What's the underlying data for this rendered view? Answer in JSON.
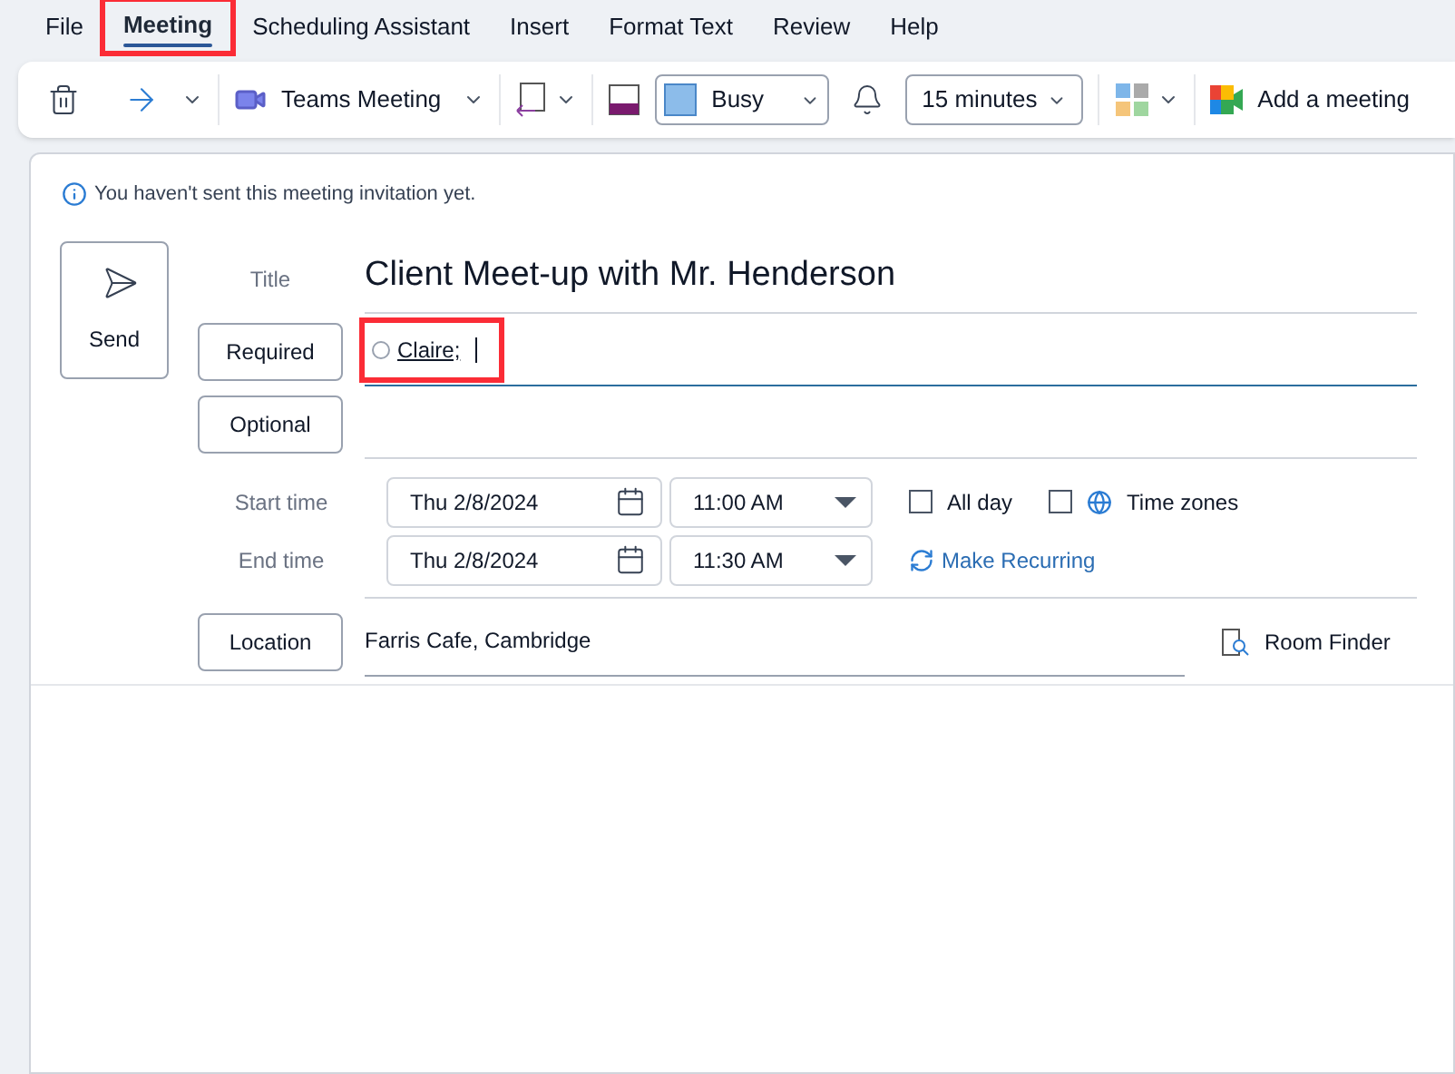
{
  "menu_tabs": [
    {
      "label": "File",
      "selected": false,
      "highlighted": false
    },
    {
      "label": "Meeting",
      "selected": true,
      "highlighted": true
    },
    {
      "label": "Scheduling Assistant",
      "selected": false,
      "highlighted": false
    },
    {
      "label": "Insert",
      "selected": false,
      "highlighted": false
    },
    {
      "label": "Format Text",
      "selected": false,
      "highlighted": false
    },
    {
      "label": "Review",
      "selected": false,
      "highlighted": false
    },
    {
      "label": "Help",
      "selected": false,
      "highlighted": false
    }
  ],
  "ribbon": {
    "teams_meeting": "Teams Meeting",
    "show_as": "Busy",
    "reminder": "15 minutes",
    "add_meeting": "Add a meeting"
  },
  "info_bar": "You haven't sent this meeting invitation yet.",
  "send_button": "Send",
  "title": {
    "label": "Title",
    "value": "Client Meet-up with Mr. Henderson"
  },
  "required": {
    "button": "Required",
    "attendees": [
      {
        "name": "Claire;",
        "highlighted": true
      }
    ]
  },
  "optional": {
    "button": "Optional"
  },
  "start": {
    "label": "Start time",
    "date": "Thu 2/8/2024",
    "time": "11:00 AM"
  },
  "end": {
    "label": "End time",
    "date": "Thu 2/8/2024",
    "time": "11:30 AM"
  },
  "all_day": {
    "label": "All day",
    "checked": false
  },
  "time_zones": {
    "label": "Time zones",
    "checked": false
  },
  "make_recurring": "Make Recurring",
  "location": {
    "button": "Location",
    "value": "Farris Cafe, Cambridge"
  },
  "room_finder": "Room Finder"
}
